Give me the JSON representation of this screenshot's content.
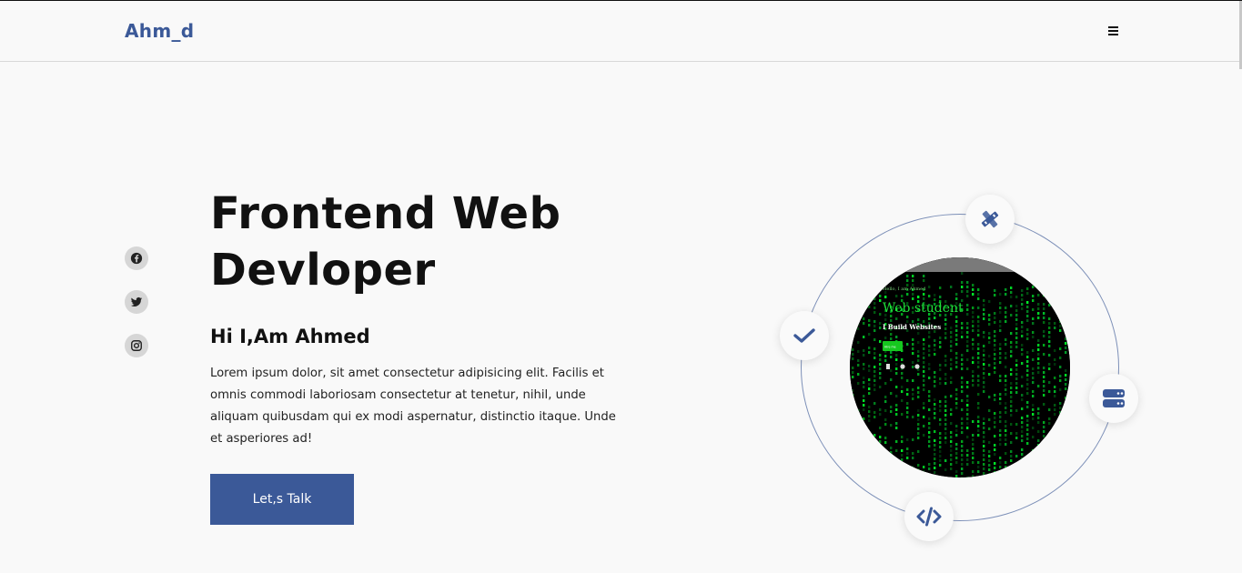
{
  "header": {
    "logo": "Ahm_d",
    "menu_icon": "hamburger-icon"
  },
  "socials": [
    {
      "name": "facebook",
      "icon": "facebook-icon"
    },
    {
      "name": "twitter",
      "icon": "twitter-icon"
    },
    {
      "name": "instagram",
      "icon": "instagram-icon"
    }
  ],
  "hero": {
    "title_line1": "Frontend Web",
    "title_line2": "Devloper",
    "subtitle": "Hi I,Am Ahmed",
    "description": "Lorem ipsum dolor, sit amet consectetur adipisicing elit. Facilis et omnis commodi laboriosam consectetur at tenetur, nihil, unde aliquam quibusdam qui ex modi aspernatur, distinctio itaque. Unde et asperiores ad!",
    "cta_label": "Let,s Talk"
  },
  "photo": {
    "small_text": "Hello, I am Ahmed",
    "heading": "Web student",
    "tagline": "I Build Websites",
    "button": "Hire me"
  },
  "orbit_icons": [
    "design-tools-icon",
    "check-icon",
    "server-icon",
    "code-icon"
  ],
  "colors": {
    "accent": "#3b5998",
    "background": "#f9f9f9",
    "matrix_green": "#00c832"
  }
}
